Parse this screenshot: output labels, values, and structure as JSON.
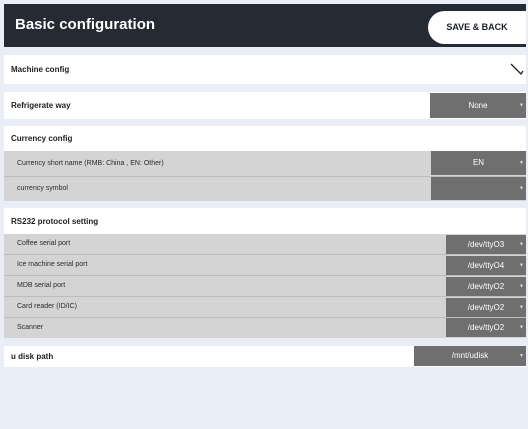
{
  "header": {
    "title": "Basic configuration",
    "save_label": "SAVE & BACK"
  },
  "machine_config": {
    "label": "Machine config"
  },
  "refrigerate": {
    "label": "Refrigerate way",
    "value": "None"
  },
  "currency": {
    "section_label": "Currency config",
    "short_name_label": "Currency short name (RMB: China , EN: Other)",
    "short_name_value": "EN",
    "symbol_label": "currency symbol",
    "symbol_value": ""
  },
  "rs232": {
    "section_label": "RS232 protocol setting",
    "ports": [
      {
        "label": "Coffee serial port",
        "value": "/dev/ttyO3"
      },
      {
        "label": "Ice machine serial port",
        "value": "/dev/ttyO4"
      },
      {
        "label": "MDB serial port",
        "value": "/dev/ttyO2"
      },
      {
        "label": "Card reader (ID/IC)",
        "value": "/dev/ttyO2"
      },
      {
        "label": "Scanner",
        "value": "/dev/ttyO2"
      }
    ]
  },
  "udisk": {
    "label": "u disk path",
    "value": "/mnt/udisk"
  }
}
